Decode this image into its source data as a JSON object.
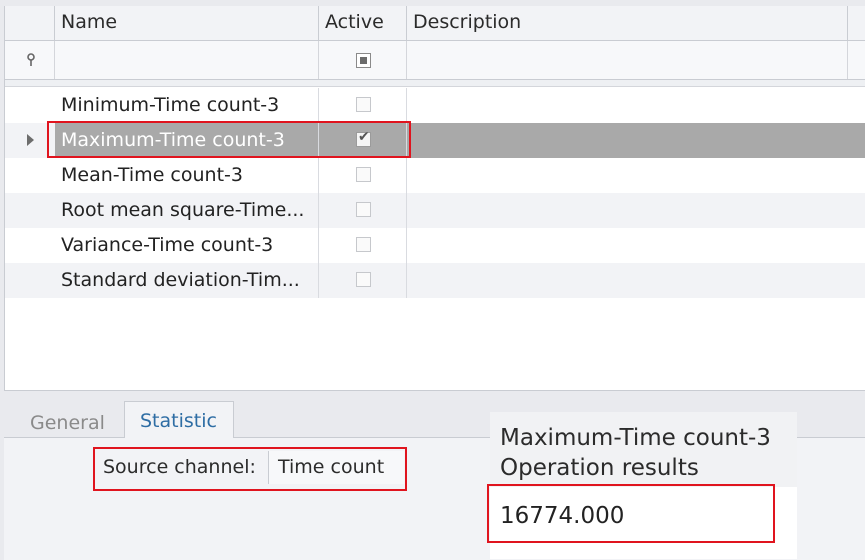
{
  "grid": {
    "columns": [
      "Name",
      "Active",
      "Description"
    ],
    "filter_icon": "pin-filter-icon",
    "rows": [
      {
        "name": "Minimum-Time count-3",
        "active": false,
        "description": ""
      },
      {
        "name": "Maximum-Time count-3",
        "active": true,
        "description": "",
        "selected": true
      },
      {
        "name": "Mean-Time count-3",
        "active": false,
        "description": ""
      },
      {
        "name": "Root mean square-Time...",
        "active": false,
        "description": ""
      },
      {
        "name": "Variance-Time count-3",
        "active": false,
        "description": ""
      },
      {
        "name": "Standard deviation-Tim...",
        "active": false,
        "description": ""
      }
    ]
  },
  "tabs": [
    {
      "label": "General",
      "active": false
    },
    {
      "label": "Statistic",
      "active": true
    }
  ],
  "statistic": {
    "source_label": "Source channel:",
    "source_value": "Time count"
  },
  "result_popup": {
    "title": "Maximum-Time count-3",
    "subtitle": "Operation results",
    "value": "16774.000"
  },
  "colors": {
    "highlight_box": "#e0141e",
    "selected_row": "#a9a9a9",
    "active_tab_text": "#2e6da4"
  }
}
